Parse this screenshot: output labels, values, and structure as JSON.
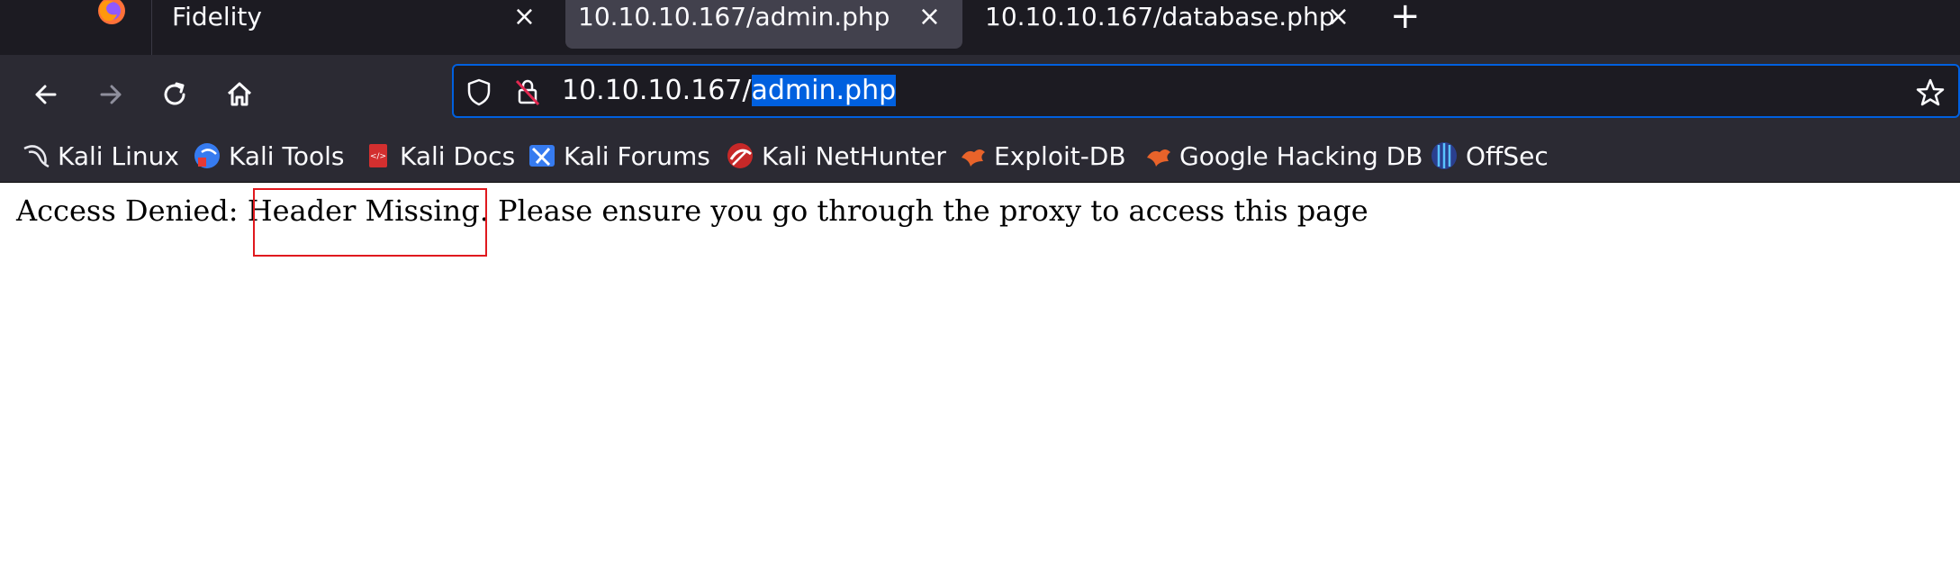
{
  "tabs": [
    {
      "label": "Fidelity",
      "active": false
    },
    {
      "label": "10.10.10.167/admin.php",
      "active": true
    },
    {
      "label": "10.10.10.167/database.php",
      "active": false
    }
  ],
  "tab_close_glyph": "×",
  "new_tab_glyph": "+",
  "url": {
    "prefix": "10.10.10.167/",
    "selected": "admin.php"
  },
  "bookmarks": [
    {
      "label": "Kali Linux",
      "icon": "kali-dragon-icon"
    },
    {
      "label": "Kali Tools",
      "icon": "kali-tools-icon"
    },
    {
      "label": "Kali Docs",
      "icon": "kali-docs-icon"
    },
    {
      "label": "Kali Forums",
      "icon": "kali-forums-icon"
    },
    {
      "label": "Kali NetHunter",
      "icon": "kali-nethunter-icon"
    },
    {
      "label": "Exploit-DB",
      "icon": "exploit-db-icon"
    },
    {
      "label": "Google Hacking DB",
      "icon": "ghdb-icon"
    },
    {
      "label": "OffSec",
      "icon": "offsec-icon"
    }
  ],
  "page": {
    "message": "Access Denied: Header Missing. Please ensure you go through the proxy to access this page"
  },
  "colors": {
    "tabstrip": "#1c1b22",
    "toolbar": "#2b2a33",
    "active_tab": "#42414d",
    "url_focus": "#0060df",
    "annotation_box": "#e0191e"
  }
}
